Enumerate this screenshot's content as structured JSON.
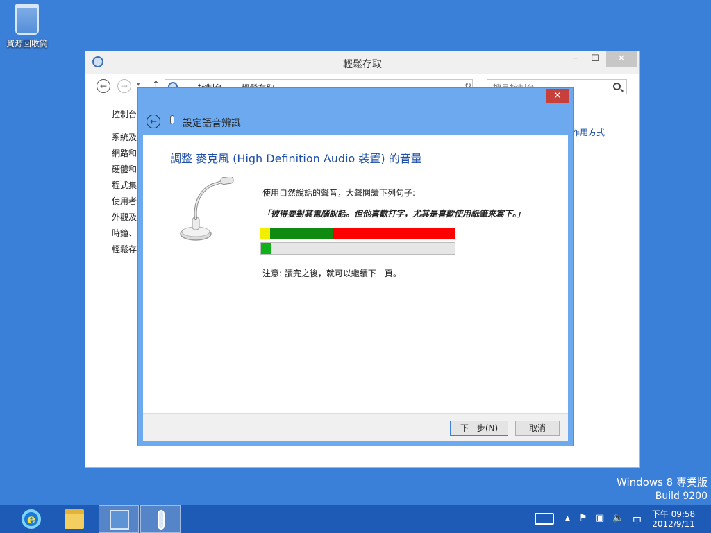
{
  "desktop": {
    "recycle_bin_label": "資源回收筒",
    "watermark_edition": "Windows 8 專業版",
    "watermark_build": "Build 9200"
  },
  "control_panel": {
    "title": "輕鬆存取",
    "minimize": "─",
    "maximize": "☐",
    "close": "✕",
    "nav_back": "←",
    "nav_forward": "→",
    "nav_up": "↑",
    "nav_history": "▾",
    "address_crumbs": [
      "控制台",
      "輕鬆存取"
    ],
    "address_dropdown": "⌄",
    "refresh": "↻",
    "search_placeholder": "搜尋控制台",
    "sidebar_home": "控制台首頁",
    "sidebar_items": [
      "系統及安全性",
      "網路和網際網路",
      "硬體和音效",
      "程式集",
      "使用者帳戶",
      "外觀及個人化",
      "時鐘、語言和區域",
      "輕鬆存取"
    ],
    "view_by": "作用方式"
  },
  "wizard": {
    "title": "設定語音辨識",
    "close": "✕",
    "back": "←",
    "heading": "調整 麥克風 (High Definition Audio 裝置) 的音量",
    "instruction": "使用自然說話的聲音，大聲閱讀下列句子:",
    "sentence": "「彼得要對其電腦說話。但他喜歡打字，尤其是喜歡使用紙筆來寫下。」",
    "meter_segments": [
      {
        "color": "#f2ee00",
        "fraction": 0.05
      },
      {
        "color": "#118a11",
        "fraction": 0.325
      },
      {
        "color": "#ff0000",
        "fraction": 0.625
      }
    ],
    "input_level": 0.05,
    "level_color": "#0fb11a",
    "note": "注意: 讀完之後，就可以繼續下一頁。",
    "next_button": "下一步(N)",
    "cancel_button": "取消"
  },
  "taskbar": {
    "apps": [
      "internet-explorer",
      "file-explorer",
      "control-panel",
      "speech-recognition"
    ],
    "ie_glyph": "e",
    "tray_up_arrow": "▲",
    "tray_flag": "⚑",
    "tray_network": "▣",
    "tray_volume": "🔈",
    "ime_label": "中",
    "time": "下午 09:58",
    "date": "2012/9/11"
  }
}
